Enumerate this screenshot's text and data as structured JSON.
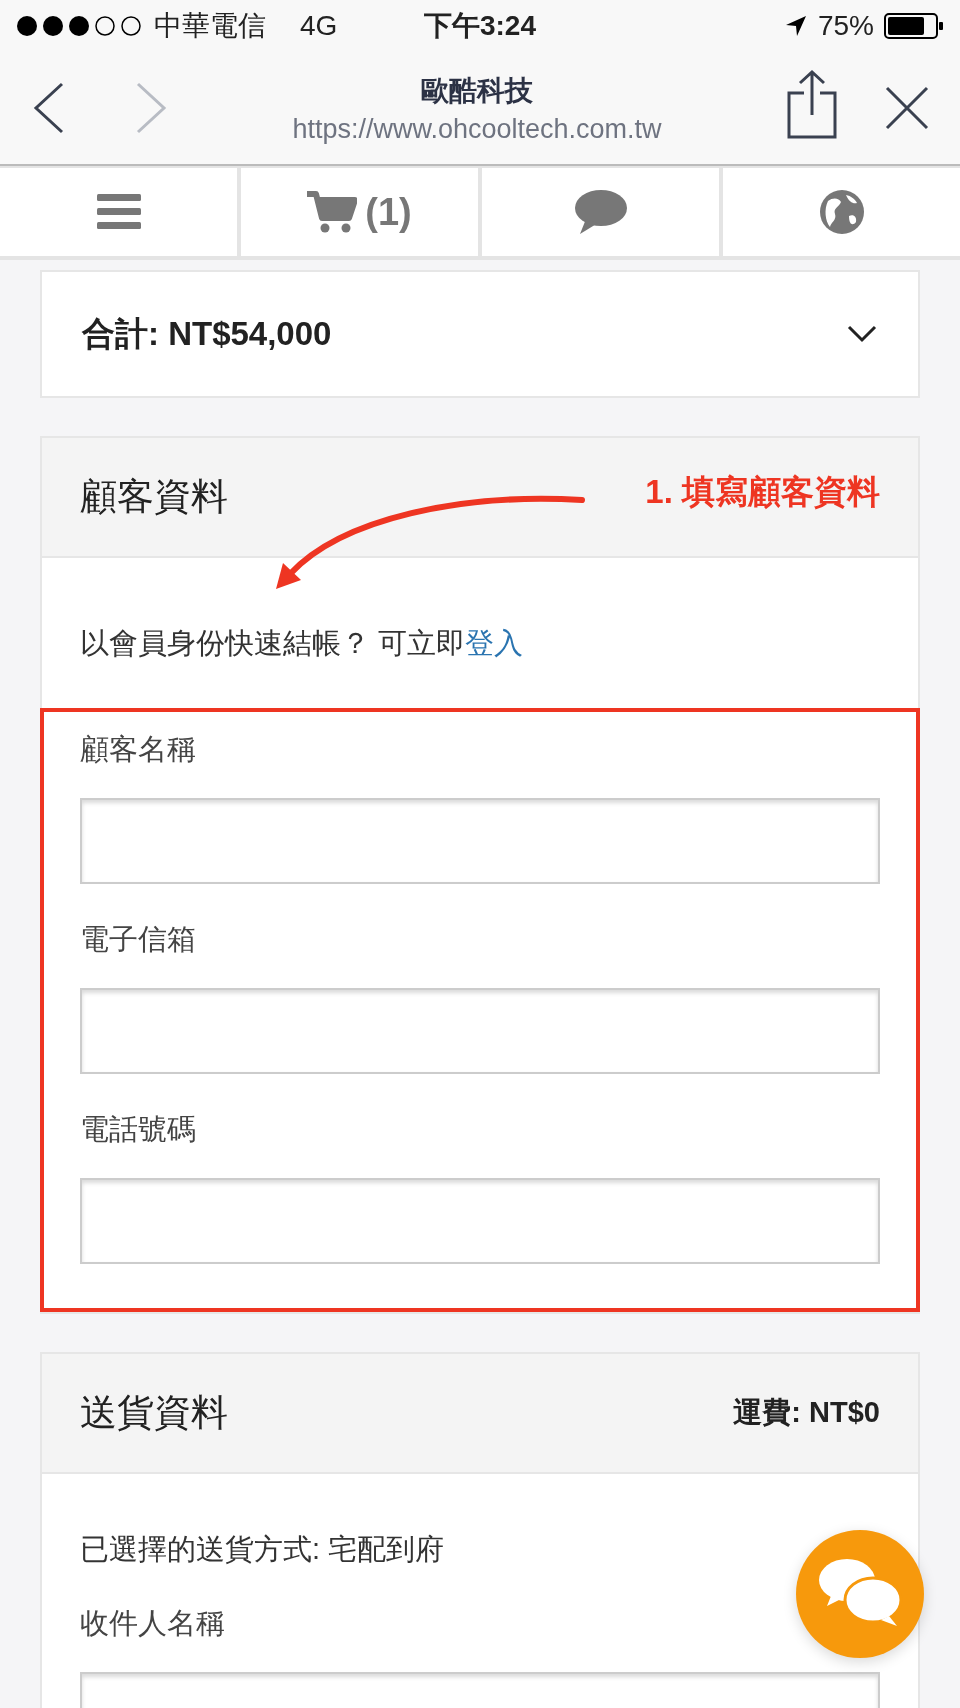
{
  "status_bar": {
    "carrier": "中華電信",
    "network": "4G",
    "time": "下午3:24",
    "battery": "75%"
  },
  "browser": {
    "title": "歐酷科技",
    "url": "https://www.ohcooltech.com.tw"
  },
  "nav": {
    "cart_count": "(1)"
  },
  "total": {
    "label": "合計: NT$54,000",
    "expanded": false
  },
  "customer": {
    "title": "顧客資料",
    "annotation": "1. 填寫顧客資料",
    "login_prompt": "以會員身份快速結帳？ 可立即",
    "login_link": "登入",
    "fields": [
      {
        "label": "顧客名稱"
      },
      {
        "label": "電子信箱"
      },
      {
        "label": "電話號碼"
      }
    ]
  },
  "shipping": {
    "title": "送貨資料",
    "fee": "運費: NT$0",
    "method": "已選擇的送貨方式: 宅配到府",
    "fields": [
      {
        "label": "收件人名稱"
      }
    ]
  }
}
